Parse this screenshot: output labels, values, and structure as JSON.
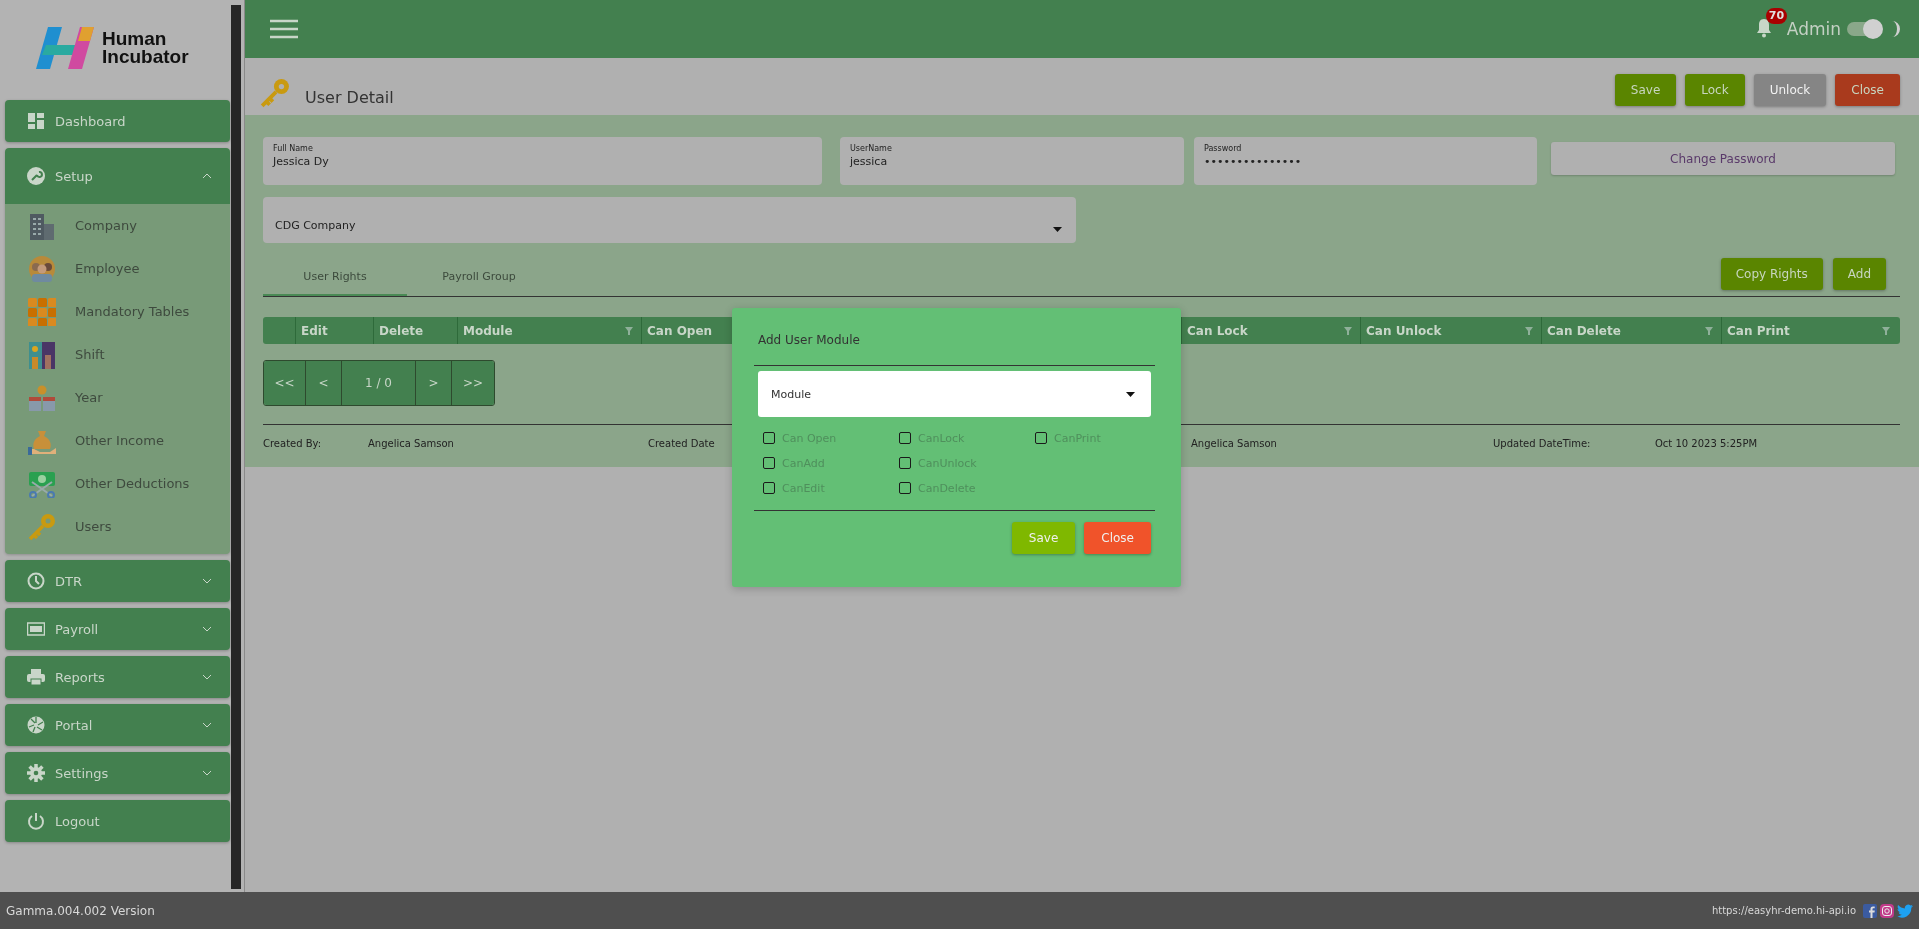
{
  "sidebar": {
    "logo": {
      "line_1": "Human",
      "line_2": "Incubator"
    },
    "items": [
      {
        "label": "Dashboard",
        "kind": "link"
      },
      {
        "label": "Setup",
        "kind": "group",
        "expanded": true,
        "children": [
          {
            "label": "Company"
          },
          {
            "label": "Employee"
          },
          {
            "label": "Mandatory Tables"
          },
          {
            "label": "Shift"
          },
          {
            "label": "Year"
          },
          {
            "label": "Other Income"
          },
          {
            "label": "Other Deductions"
          },
          {
            "label": "Users"
          }
        ]
      },
      {
        "label": "DTR",
        "kind": "group",
        "expanded": false
      },
      {
        "label": "Payroll",
        "kind": "group",
        "expanded": false
      },
      {
        "label": "Reports",
        "kind": "group",
        "expanded": false
      },
      {
        "label": "Portal",
        "kind": "group",
        "expanded": false
      },
      {
        "label": "Settings",
        "kind": "group",
        "expanded": false
      },
      {
        "label": "Logout",
        "kind": "link"
      }
    ]
  },
  "header": {
    "notification_count": "70",
    "user": "Admin",
    "theme_toggle": {
      "on": true
    }
  },
  "page": {
    "title": "User Detail",
    "actions": [
      {
        "label": "Save",
        "kind": "primary",
        "disabled": false
      },
      {
        "label": "Lock",
        "kind": "primary",
        "disabled": false
      },
      {
        "label": "Unlock",
        "kind": "primary",
        "disabled": true
      },
      {
        "label": "Close",
        "kind": "danger",
        "disabled": false
      }
    ],
    "fields": [
      {
        "label": "Full Name",
        "value": "Jessica Dy"
      },
      {
        "label": "UserName",
        "value": "jessica"
      },
      {
        "label": "Password",
        "value": "•••••••••••••••"
      }
    ],
    "change_password_button": "Change Password",
    "company_select": {
      "value": "CDG Company"
    },
    "tabs": [
      {
        "label": "User Rights",
        "selected": true
      },
      {
        "label": "Payroll Group",
        "selected": false
      }
    ],
    "tab_actions": [
      "Copy Rights",
      "Add"
    ],
    "table": {
      "columns": [
        {
          "label": "Edit",
          "filterable": false
        },
        {
          "label": "Delete",
          "filterable": false
        },
        {
          "label": "Module",
          "filterable": true
        },
        {
          "label": "Can Open"
        },
        {
          "label": "Can Lock",
          "filterable": true
        },
        {
          "label": "Can Unlock",
          "filterable": true
        },
        {
          "label": "Can Delete",
          "filterable": true
        },
        {
          "label": "Can Print",
          "filterable": true
        }
      ]
    },
    "pager": [
      "<<",
      "<",
      "1 / 0",
      ">",
      ">>"
    ],
    "record_info": [
      "Created By:",
      "Angelica Samson",
      "Created Date",
      "Angelica Samson",
      "Updated DateTime:",
      "Oct 10 2023 5:25PM"
    ]
  },
  "dialog": {
    "title": "Add User Module",
    "module_select": {
      "placeholder": "Module"
    },
    "permissions": [
      {
        "label": "Can Open",
        "checked": false,
        "disabled": true
      },
      {
        "label": "CanAdd",
        "checked": false,
        "disabled": true
      },
      {
        "label": "CanEdit",
        "checked": false,
        "disabled": true
      },
      {
        "label": "CanLock",
        "checked": false,
        "disabled": true
      },
      {
        "label": "CanUnlock",
        "checked": false,
        "disabled": true
      },
      {
        "label": "CanDelete",
        "checked": false,
        "disabled": true
      },
      {
        "label": "CanPrint",
        "checked": false,
        "disabled": true
      }
    ],
    "buttons": [
      {
        "label": "Save",
        "kind": "save"
      },
      {
        "label": "Close",
        "kind": "close"
      }
    ]
  },
  "footer": {
    "version": "Gamma.004.002 Version",
    "url": "https://easyhr-demo.hi-api.io"
  }
}
